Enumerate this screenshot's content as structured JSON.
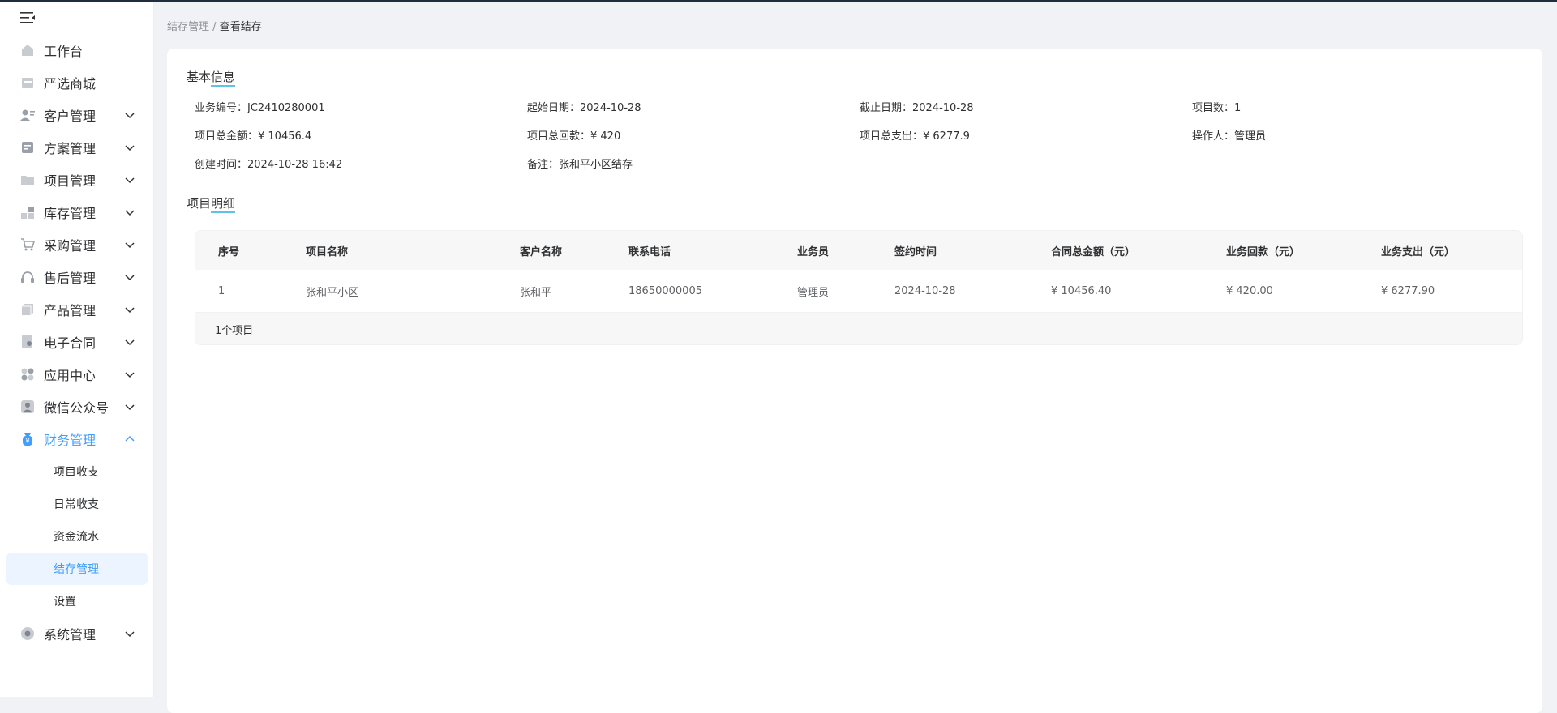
{
  "sidebar": {
    "items": [
      {
        "label": "工作台",
        "icon": "home-icon",
        "expandable": false
      },
      {
        "label": "严选商城",
        "icon": "store-icon",
        "expandable": false
      },
      {
        "label": "客户管理",
        "icon": "customer-icon",
        "expandable": true
      },
      {
        "label": "方案管理",
        "icon": "plan-icon",
        "expandable": true
      },
      {
        "label": "项目管理",
        "icon": "folder-icon",
        "expandable": true
      },
      {
        "label": "库存管理",
        "icon": "inventory-icon",
        "expandable": true
      },
      {
        "label": "采购管理",
        "icon": "cart-icon",
        "expandable": true
      },
      {
        "label": "售后管理",
        "icon": "headset-icon",
        "expandable": true
      },
      {
        "label": "产品管理",
        "icon": "box-icon",
        "expandable": true
      },
      {
        "label": "电子合同",
        "icon": "contract-icon",
        "expandable": true
      },
      {
        "label": "应用中心",
        "icon": "apps-icon",
        "expandable": true
      },
      {
        "label": "微信公众号",
        "icon": "user-icon",
        "expandable": true
      },
      {
        "label": "财务管理",
        "icon": "finance-icon",
        "expandable": true,
        "expanded": true
      },
      {
        "label": "系统管理",
        "icon": "settings-icon",
        "expandable": true
      }
    ],
    "finance_sub": [
      "项目收支",
      "日常收支",
      "资金流水",
      "结存管理",
      "设置"
    ],
    "active_sub": "结存管理"
  },
  "breadcrumb": {
    "parent": "结存管理",
    "separator": "/",
    "current": "查看结存"
  },
  "basic_info": {
    "title_a": "基本",
    "title_b": "信息",
    "fields": [
      "业务编号：JC2410280001",
      "起始日期：2024-10-28",
      "截止日期：2024-10-28",
      "项目数：1",
      "项目总金额：¥ 10456.4",
      "项目总回款：¥ 420",
      "项目总支出：¥ 6277.9",
      "操作人：管理员",
      "创建时间：2024-10-28 16:42",
      "备注：张和平小区结存"
    ]
  },
  "detail": {
    "title_a": "项目",
    "title_b": "明细",
    "columns": [
      "序号",
      "项目名称",
      "客户名称",
      "联系电话",
      "业务员",
      "签约时间",
      "合同总金额（元）",
      "业务回款（元）",
      "业务支出（元）"
    ],
    "rows": [
      [
        "1",
        "张和平小区",
        "张和平",
        "18650000005",
        "管理员",
        "2024-10-28",
        "¥ 10456.40",
        "¥ 420.00",
        "¥ 6277.90"
      ]
    ],
    "footer": "1个项目"
  },
  "colors": {
    "accent": "#409eff",
    "underline": "#5fc3e8",
    "active_bg": "#ecf5ff"
  }
}
